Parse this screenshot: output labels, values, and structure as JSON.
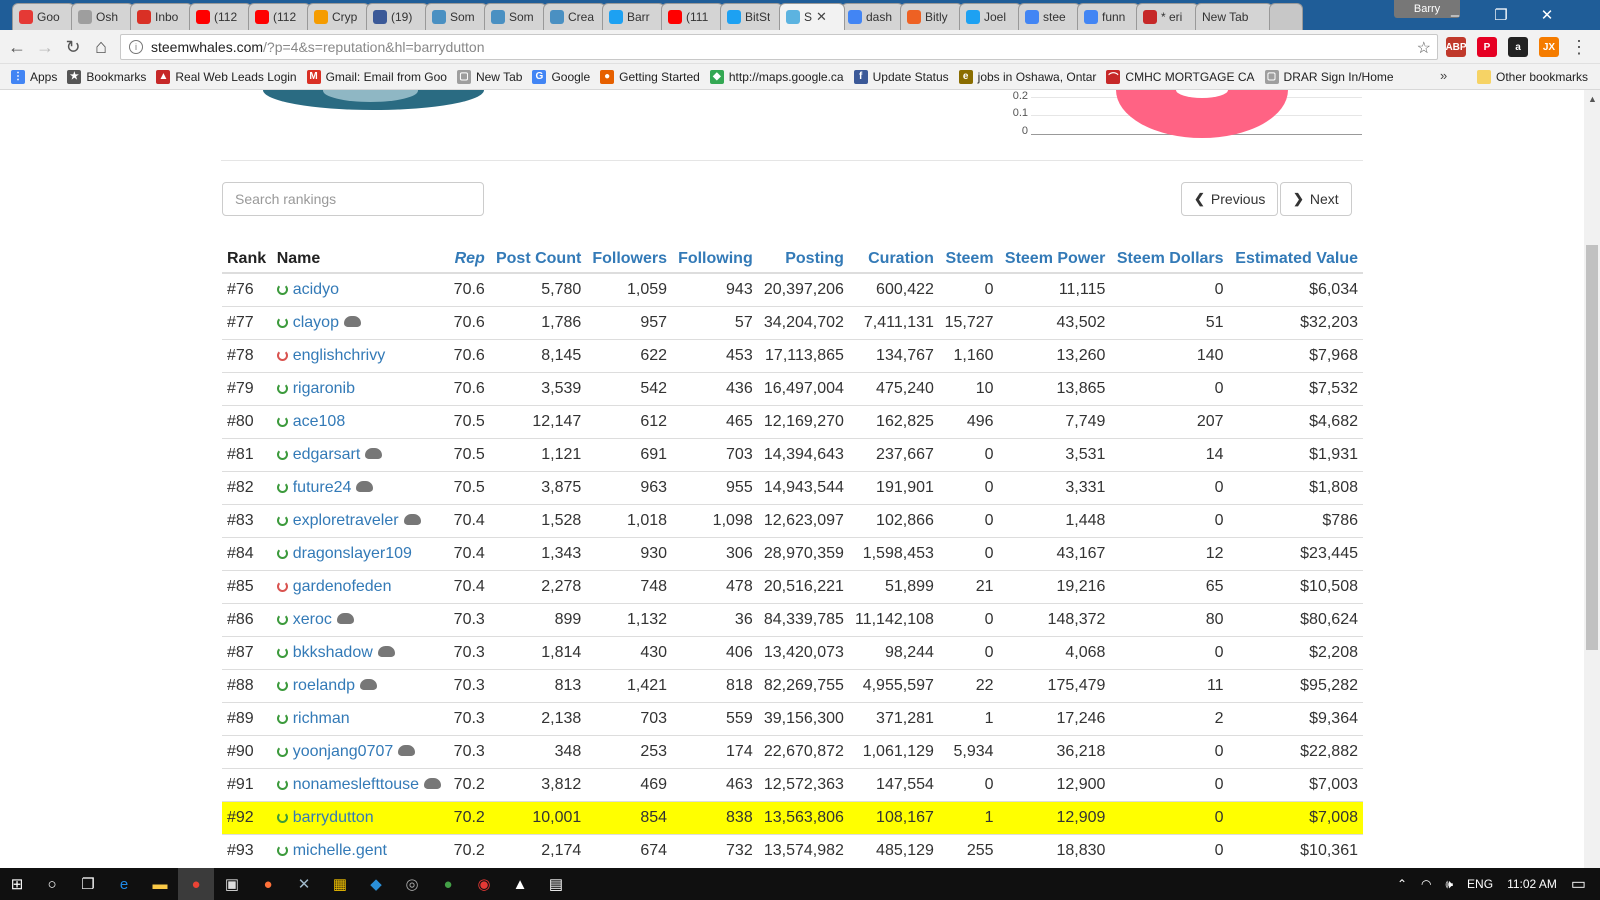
{
  "browser": {
    "tabs": [
      {
        "title": "Goo",
        "color": "#e53935"
      },
      {
        "title": "Osh",
        "color": "#9e9e9e"
      },
      {
        "title": "Inbo",
        "color": "#d93025"
      },
      {
        "title": "(112",
        "color": "#ff0000"
      },
      {
        "title": "(112",
        "color": "#ff0000"
      },
      {
        "title": "Cryp",
        "color": "#f59c00"
      },
      {
        "title": "(19)",
        "color": "#3b5998"
      },
      {
        "title": "Som",
        "color": "#4a90c2"
      },
      {
        "title": "Som",
        "color": "#4a90c2"
      },
      {
        "title": "Crea",
        "color": "#4a90c2"
      },
      {
        "title": "Barr",
        "color": "#1da1f2"
      },
      {
        "title": "(111",
        "color": "#ff0000"
      },
      {
        "title": "BitSt",
        "color": "#1da1f2"
      }
    ],
    "active_tab": {
      "title": "S",
      "color": "#5cb3e0"
    },
    "tabs_after": [
      {
        "title": "dash",
        "color": "#4285f4"
      },
      {
        "title": "Bitly",
        "color": "#ee6123"
      },
      {
        "title": "Joel",
        "color": "#1da1f2"
      },
      {
        "title": "stee",
        "color": "#4285f4"
      },
      {
        "title": "funn",
        "color": "#4285f4"
      },
      {
        "title": "* eri",
        "color": "#c62828"
      }
    ],
    "new_tab_label": "New Tab",
    "profile_name": "Barry",
    "window": {
      "minimize": "–",
      "restore": "❐",
      "close": "✕"
    },
    "nav": {
      "back": "←",
      "forward": "→",
      "reload": "↻",
      "home": "⌂"
    },
    "url_domain": "steemwhales.com",
    "url_path": "/?p=4&s=reputation&hl=barrydutton",
    "star": "☆",
    "extensions": [
      {
        "label": "ABP",
        "color": "#c0392b"
      },
      {
        "label": "P",
        "color": "#e60023"
      },
      {
        "label": "a",
        "color": "#222222"
      },
      {
        "label": "JX",
        "color": "#f57c00"
      }
    ],
    "menu": "⋮"
  },
  "bookmarks": [
    {
      "label": "Apps",
      "color": "#4285f4",
      "glyph": "⋮"
    },
    {
      "label": "Bookmarks",
      "color": "#555555",
      "glyph": "★"
    },
    {
      "label": "Real Web Leads Login",
      "color": "#c62828",
      "glyph": "▲"
    },
    {
      "label": "Gmail: Email from Goo",
      "color": "#d93025",
      "glyph": "M"
    },
    {
      "label": "New Tab",
      "color": "#9e9e9e",
      "glyph": "▢"
    },
    {
      "label": "Google",
      "color": "#4285f4",
      "glyph": "G"
    },
    {
      "label": "Getting Started",
      "color": "#e66000",
      "glyph": "●"
    },
    {
      "label": "http://maps.google.ca",
      "color": "#34a853",
      "glyph": "◆"
    },
    {
      "label": "Update Status",
      "color": "#3b5998",
      "glyph": "f"
    },
    {
      "label": "jobs in Oshawa, Ontar",
      "color": "#8a6d00",
      "glyph": "e"
    },
    {
      "label": "CMHC MORTGAGE CA",
      "color": "#c62828",
      "glyph": "⌒"
    },
    {
      "label": "DRAR Sign In/Home",
      "color": "#9e9e9e",
      "glyph": "▢"
    }
  ],
  "bookmarks_more": "»",
  "other_bookmarks": "Other bookmarks",
  "mini_chart": {
    "ticks": [
      "0.2",
      "0.1",
      "0"
    ]
  },
  "search": {
    "placeholder": "Search rankings"
  },
  "pager": {
    "previous": "Previous",
    "next": "Next"
  },
  "table": {
    "headers": [
      "Rank",
      "Name",
      "Rep",
      "Post Count",
      "Followers",
      "Following",
      "Posting",
      "Curation",
      "Steem",
      "Steem Power",
      "Steem Dollars",
      "Estimated Value"
    ],
    "highlight_color": "#ffff00",
    "rows": [
      {
        "rank": "#76",
        "name": "acidyo",
        "online": true,
        "whale": false,
        "rep": "70.6",
        "posts": "5,780",
        "followers": "1,059",
        "following": "943",
        "posting": "20,397,206",
        "curation": "600,422",
        "steem": "0",
        "sp": "11,115",
        "sbd": "0",
        "value": "$6,034"
      },
      {
        "rank": "#77",
        "name": "clayop",
        "online": true,
        "whale": true,
        "rep": "70.6",
        "posts": "1,786",
        "followers": "957",
        "following": "57",
        "posting": "34,204,702",
        "curation": "7,411,131",
        "steem": "15,727",
        "sp": "43,502",
        "sbd": "51",
        "value": "$32,203"
      },
      {
        "rank": "#78",
        "name": "englishchrivy",
        "online": false,
        "whale": false,
        "rep": "70.6",
        "posts": "8,145",
        "followers": "622",
        "following": "453",
        "posting": "17,113,865",
        "curation": "134,767",
        "steem": "1,160",
        "sp": "13,260",
        "sbd": "140",
        "value": "$7,968"
      },
      {
        "rank": "#79",
        "name": "rigaronib",
        "online": true,
        "whale": false,
        "rep": "70.6",
        "posts": "3,539",
        "followers": "542",
        "following": "436",
        "posting": "16,497,004",
        "curation": "475,240",
        "steem": "10",
        "sp": "13,865",
        "sbd": "0",
        "value": "$7,532"
      },
      {
        "rank": "#80",
        "name": "ace108",
        "online": true,
        "whale": false,
        "rep": "70.5",
        "posts": "12,147",
        "followers": "612",
        "following": "465",
        "posting": "12,169,270",
        "curation": "162,825",
        "steem": "496",
        "sp": "7,749",
        "sbd": "207",
        "value": "$4,682"
      },
      {
        "rank": "#81",
        "name": "edgarsart",
        "online": true,
        "whale": true,
        "rep": "70.5",
        "posts": "1,121",
        "followers": "691",
        "following": "703",
        "posting": "14,394,643",
        "curation": "237,667",
        "steem": "0",
        "sp": "3,531",
        "sbd": "14",
        "value": "$1,931"
      },
      {
        "rank": "#82",
        "name": "future24",
        "online": true,
        "whale": true,
        "rep": "70.5",
        "posts": "3,875",
        "followers": "963",
        "following": "955",
        "posting": "14,943,544",
        "curation": "191,901",
        "steem": "0",
        "sp": "3,331",
        "sbd": "0",
        "value": "$1,808"
      },
      {
        "rank": "#83",
        "name": "exploretraveler",
        "online": true,
        "whale": true,
        "rep": "70.4",
        "posts": "1,528",
        "followers": "1,018",
        "following": "1,098",
        "posting": "12,623,097",
        "curation": "102,866",
        "steem": "0",
        "sp": "1,448",
        "sbd": "0",
        "value": "$786"
      },
      {
        "rank": "#84",
        "name": "dragonslayer109",
        "online": true,
        "whale": false,
        "rep": "70.4",
        "posts": "1,343",
        "followers": "930",
        "following": "306",
        "posting": "28,970,359",
        "curation": "1,598,453",
        "steem": "0",
        "sp": "43,167",
        "sbd": "12",
        "value": "$23,445"
      },
      {
        "rank": "#85",
        "name": "gardenofeden",
        "online": false,
        "whale": false,
        "rep": "70.4",
        "posts": "2,278",
        "followers": "748",
        "following": "478",
        "posting": "20,516,221",
        "curation": "51,899",
        "steem": "21",
        "sp": "19,216",
        "sbd": "65",
        "value": "$10,508"
      },
      {
        "rank": "#86",
        "name": "xeroc",
        "online": true,
        "whale": true,
        "rep": "70.3",
        "posts": "899",
        "followers": "1,132",
        "following": "36",
        "posting": "84,339,785",
        "curation": "11,142,108",
        "steem": "0",
        "sp": "148,372",
        "sbd": "80",
        "value": "$80,624"
      },
      {
        "rank": "#87",
        "name": "bkkshadow",
        "online": true,
        "whale": true,
        "rep": "70.3",
        "posts": "1,814",
        "followers": "430",
        "following": "406",
        "posting": "13,420,073",
        "curation": "98,244",
        "steem": "0",
        "sp": "4,068",
        "sbd": "0",
        "value": "$2,208"
      },
      {
        "rank": "#88",
        "name": "roelandp",
        "online": true,
        "whale": true,
        "rep": "70.3",
        "posts": "813",
        "followers": "1,421",
        "following": "818",
        "posting": "82,269,755",
        "curation": "4,955,597",
        "steem": "22",
        "sp": "175,479",
        "sbd": "11",
        "value": "$95,282"
      },
      {
        "rank": "#89",
        "name": "richman",
        "online": true,
        "whale": false,
        "rep": "70.3",
        "posts": "2,138",
        "followers": "703",
        "following": "559",
        "posting": "39,156,300",
        "curation": "371,281",
        "steem": "1",
        "sp": "17,246",
        "sbd": "2",
        "value": "$9,364"
      },
      {
        "rank": "#90",
        "name": "yoonjang0707",
        "online": true,
        "whale": true,
        "rep": "70.3",
        "posts": "348",
        "followers": "253",
        "following": "174",
        "posting": "22,670,872",
        "curation": "1,061,129",
        "steem": "5,934",
        "sp": "36,218",
        "sbd": "0",
        "value": "$22,882"
      },
      {
        "rank": "#91",
        "name": "nonameslefttouse",
        "online": true,
        "whale": true,
        "rep": "70.2",
        "posts": "3,812",
        "followers": "469",
        "following": "463",
        "posting": "12,572,363",
        "curation": "147,554",
        "steem": "0",
        "sp": "12,900",
        "sbd": "0",
        "value": "$7,003"
      },
      {
        "rank": "#92",
        "name": "barrydutton",
        "online": true,
        "whale": false,
        "highlight": true,
        "rep": "70.2",
        "posts": "10,001",
        "followers": "854",
        "following": "838",
        "posting": "13,563,806",
        "curation": "108,167",
        "steem": "1",
        "sp": "12,909",
        "sbd": "0",
        "value": "$7,008"
      },
      {
        "rank": "#93",
        "name": "michelle.gent",
        "online": true,
        "whale": false,
        "rep": "70.2",
        "posts": "2,174",
        "followers": "674",
        "following": "732",
        "posting": "13,574,982",
        "curation": "485,129",
        "steem": "255",
        "sp": "18,830",
        "sbd": "0",
        "value": "$10,361"
      }
    ]
  },
  "taskbar": {
    "apps": [
      {
        "name": "start",
        "color": "#ffffff",
        "glyph": "⊞"
      },
      {
        "name": "cortana",
        "color": "#ffffff",
        "glyph": "○"
      },
      {
        "name": "task-view",
        "color": "#ffffff",
        "glyph": "❐"
      },
      {
        "name": "edge",
        "color": "#1e88e5",
        "glyph": "e"
      },
      {
        "name": "explorer",
        "color": "#f9c846",
        "glyph": "▬"
      },
      {
        "name": "chrome",
        "color": "#ea4335",
        "glyph": "●"
      },
      {
        "name": "store",
        "color": "#dddddd",
        "glyph": "▣"
      },
      {
        "name": "firefox",
        "color": "#ff7139",
        "glyph": "●"
      },
      {
        "name": "app-x",
        "color": "#9fb8c9",
        "glyph": "✕"
      },
      {
        "name": "calc-grid",
        "color": "#f0c000",
        "glyph": "▦"
      },
      {
        "name": "app-diamond",
        "color": "#2a8fd8",
        "glyph": "◆"
      },
      {
        "name": "app-globe",
        "color": "#aaaaaa",
        "glyph": "◎"
      },
      {
        "name": "app-green",
        "color": "#43a047",
        "glyph": "●"
      },
      {
        "name": "app-red",
        "color": "#e53935",
        "glyph": "◉"
      },
      {
        "name": "photos",
        "color": "#ffffff",
        "glyph": "▲"
      },
      {
        "name": "calculator",
        "color": "#ffffff",
        "glyph": "▤"
      }
    ],
    "lang": "ENG",
    "time": "11:02 AM",
    "notifications": "▭"
  }
}
